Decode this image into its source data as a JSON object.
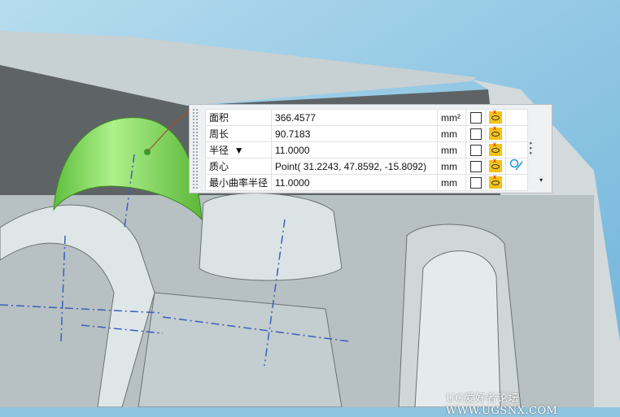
{
  "measure_panel": {
    "rows": [
      {
        "label": "面积",
        "value": "366.4577",
        "unit": "mm²"
      },
      {
        "label": "周长",
        "value": "90.7183",
        "unit": "mm"
      },
      {
        "label": "半径",
        "dropdown": "▼",
        "value": "11.0000",
        "unit": "mm"
      },
      {
        "label": "质心",
        "value": "Point( 31.2243, 47.8592, -15.8092)",
        "unit": "mm"
      },
      {
        "label": "最小曲率半径",
        "value": "11.0000",
        "unit": "mm"
      }
    ],
    "side_arrows": "▸▸▸",
    "dropdown": "▾"
  },
  "watermark": "UG爱好者论坛 WWW.UGSNX.COM",
  "colors": {
    "sky": "#8fc4e0",
    "part": "#c9d1d3",
    "cavity": "#5c6264",
    "highlight": "#7ede5a"
  }
}
